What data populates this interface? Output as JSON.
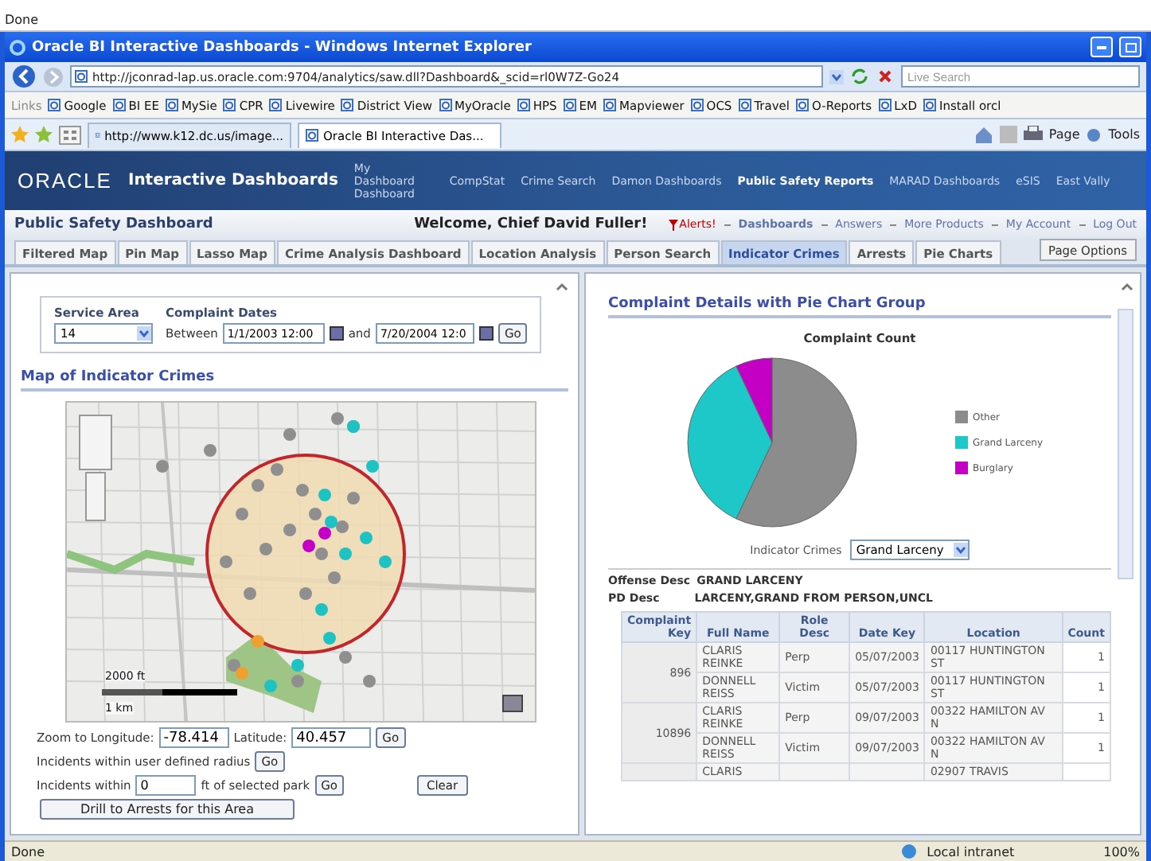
{
  "top_status": "Done",
  "window": {
    "title": "Oracle BI Interactive Dashboards - Windows Internet Explorer"
  },
  "address_bar": {
    "url": "http://jconrad-lap.us.oracle.com:9704/analytics/saw.dll?Dashboard&_scid=rl0W7Z-Go24",
    "search_placeholder": "Live Search"
  },
  "links_bar": {
    "label": "Links",
    "items": [
      {
        "label": "Google"
      },
      {
        "label": "BI EE"
      },
      {
        "label": "MySie"
      },
      {
        "label": "CPR"
      },
      {
        "label": "Livewire"
      },
      {
        "label": "District View"
      },
      {
        "label": "MyOracle"
      },
      {
        "label": "HPS"
      },
      {
        "label": "EM"
      },
      {
        "label": "Mapviewer"
      },
      {
        "label": "OCS"
      },
      {
        "label": "Travel"
      },
      {
        "label": "O-Reports"
      },
      {
        "label": "LxD"
      },
      {
        "label": "Install orcl"
      }
    ]
  },
  "browser_tabs": [
    {
      "label": "http://www.k12.dc.us/image...",
      "selected": false
    },
    {
      "label": "Oracle BI Interactive Das...",
      "selected": true
    }
  ],
  "command_bar": [
    "Page",
    "Tools"
  ],
  "app_header": {
    "logo": "ORACLE",
    "title": "Interactive Dashboards",
    "nav": [
      {
        "label": "My Dashboard Dashboard",
        "selected": false
      },
      {
        "label": "CompStat",
        "selected": false
      },
      {
        "label": "Crime Search",
        "selected": false
      },
      {
        "label": "Damon Dashboards",
        "selected": false
      },
      {
        "label": "Public Safety Reports",
        "selected": true
      },
      {
        "label": "MARAD Dashboards",
        "selected": false
      },
      {
        "label": "eSIS",
        "selected": false
      },
      {
        "label": "East Vally",
        "selected": false
      }
    ]
  },
  "dashboard_bar": {
    "title": "Public Safety Dashboard",
    "welcome": "Welcome, Chief David Fuller!",
    "alert": "Alerts!",
    "links": [
      "Dashboards",
      "Answers",
      "More Products",
      "My Account",
      "Log Out"
    ]
  },
  "page_tabs": [
    {
      "label": "Filtered Map",
      "selected": false
    },
    {
      "label": "Pin Map",
      "selected": false
    },
    {
      "label": "Lasso Map",
      "selected": false
    },
    {
      "label": "Crime Analysis Dashboard",
      "selected": false
    },
    {
      "label": "Location Analysis",
      "selected": false
    },
    {
      "label": "Person Search",
      "selected": false
    },
    {
      "label": "Indicator Crimes",
      "selected": true
    },
    {
      "label": "Arrests",
      "selected": false
    },
    {
      "label": "Pie Charts",
      "selected": false
    }
  ],
  "page_options": "Page Options",
  "filters": {
    "service_area_label": "Service Area",
    "service_area": "14",
    "dates_label": "Complaint Dates",
    "between": "Between",
    "from": "1/1/2003 12:00",
    "and": "and",
    "to": "7/20/2004 12:0",
    "go": "Go"
  },
  "map_panel": {
    "heading": "Map of Indicator Crimes",
    "scale_ft": "2000 ft",
    "scale_km": "1 km",
    "zoom_label": "Zoom to Longitude:",
    "longitude": "-78.414",
    "latitude_label": "Latitude:",
    "latitude": "40.457",
    "zoom_go": "Go",
    "radius_label": "Incidents within user defined radius",
    "radius_go": "Go",
    "park_label": "Incidents within",
    "park_distance": "0",
    "park_suffix": "ft of selected park",
    "park_go": "Go",
    "clear": "Clear",
    "drill": "Drill to Arrests for this Area"
  },
  "details_panel": {
    "heading": "Complaint Details with Pie Chart Group",
    "chart_title": "Complaint Count",
    "legend": [
      {
        "label": "Other",
        "color": "#8c8c8c"
      },
      {
        "label": "Grand Larceny",
        "color": "#1fc8c8"
      },
      {
        "label": "Burglary",
        "color": "#c400c4"
      }
    ],
    "selector_label": "Indicator Crimes",
    "selector_value": "Grand Larceny",
    "offense_label": "Offense Desc",
    "offense": "GRAND LARCENY",
    "pd_label": "PD Desc",
    "pd": "LARCENY,GRAND FROM PERSON,UNCL",
    "table": {
      "columns": [
        "Complaint Key",
        "Full Name",
        "Role Desc",
        "Date Key",
        "Location",
        "Count"
      ],
      "groups": [
        {
          "key": "896",
          "rows": [
            {
              "full_name": "CLARIS REINKE",
              "role": "Perp",
              "date": "05/07/2003",
              "location": "00117 HUNTINGTON ST",
              "count": "1"
            },
            {
              "full_name": "DONNELL REISS",
              "role": "Victim",
              "date": "05/07/2003",
              "location": "00117 HUNTINGTON ST",
              "count": "1"
            }
          ]
        },
        {
          "key": "10896",
          "rows": [
            {
              "full_name": "CLARIS REINKE",
              "role": "Perp",
              "date": "09/07/2003",
              "location": "00322 HAMILTON AV N",
              "count": "1"
            },
            {
              "full_name": "DONNELL REISS",
              "role": "Victim",
              "date": "09/07/2003",
              "location": "00322 HAMILTON AV N",
              "count": "1"
            }
          ]
        },
        {
          "rows": [
            {
              "full_name": "CLARIS",
              "location": "02907 TRAVIS"
            }
          ]
        }
      ]
    }
  },
  "status_bar": {
    "text": "Done",
    "zone": "Local intranet",
    "zoom": "100%"
  }
}
